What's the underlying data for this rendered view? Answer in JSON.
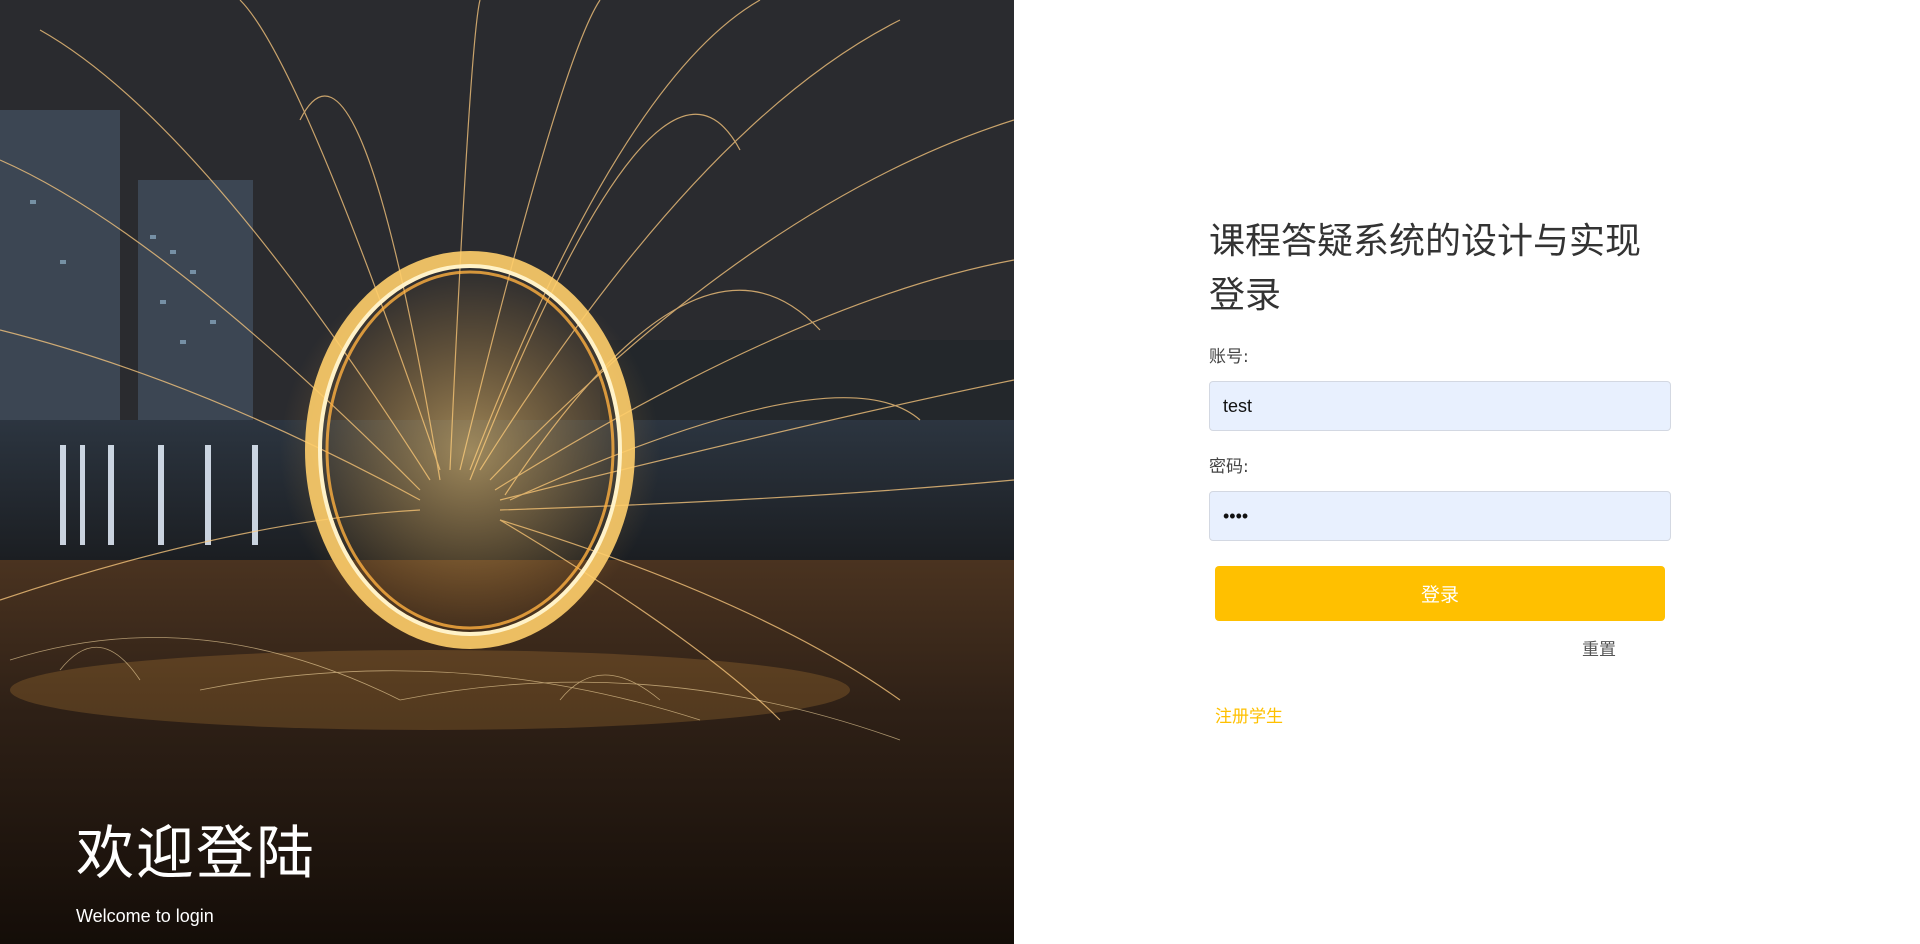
{
  "hero": {
    "title": "欢迎登陆",
    "subtitle": "Welcome to login"
  },
  "login": {
    "title": "课程答疑系统的设计与实现登录",
    "account_label": "账号:",
    "account_value": "test",
    "password_label": "密码:",
    "password_value": "1234",
    "submit_label": "登录",
    "reset_label": "重置",
    "register_label": "注册学生"
  },
  "colors": {
    "accent": "#ffc000",
    "input_background": "#e8f0fe",
    "title_text": "#333333"
  }
}
